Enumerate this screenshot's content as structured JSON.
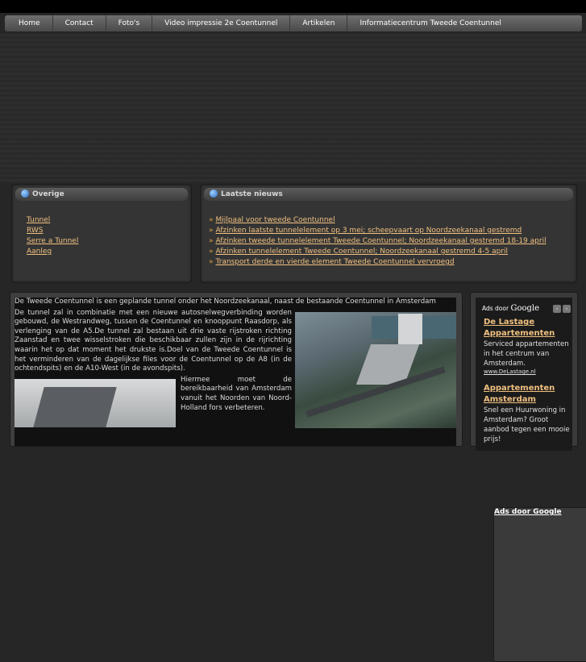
{
  "nav": {
    "items": [
      "Home",
      "Contact",
      "Foto's",
      "Video impressie 2e Coentunnel",
      "Artikelen",
      "Informatiecentrum Tweede Coentunnel"
    ]
  },
  "overige": {
    "title": "Overige",
    "ads_label": "Ads door Google",
    "links": [
      "Tunnel",
      "RWS",
      "Serre a Tunnel",
      "Aanleg"
    ]
  },
  "news": {
    "title": "Laatste nieuws",
    "items": [
      "Mijlpaal voor tweede Coentunnel",
      "Afzinken laatste tunnelelement op 3 mei; scheepvaart op Noordzeekanaal gestremd",
      "Afzinken tweede tunnelelement Tweede Coentunnel; Noordzeekanaal gestremd 18-19 april",
      "Afzinken tunnelelement Tweede Coentunnel; Noordzeekanaal gestremd 4-5 april",
      "Transport derde en vierde element Tweede Coentunnel vervroegd"
    ]
  },
  "article": {
    "p1": "De Tweede Coentunnel is een geplande tunnel onder het Noordzeekanaal, naast de bestaande Coentunnel in Amsterdam",
    "p2": "De tunnel zal in combinatie met een nieuwe autosnelwegverbinding worden gebouwd, de Westrandweg, tussen de Coentunnel en knooppunt Raasdorp, als verlenging van de A5.De tunnel zal bestaan uit drie vaste rijstroken richting Zaanstad en twee wisselstroken die beschikbaar zullen zijn in de rijrichting waarin het op dat moment het drukste is.Doel van de Tweede Coentunnel is het verminderen van de dagelijkse files voor de Coentunnel op de A8 (in de ochtendspits) en de A10-West (in de avondspits).",
    "p3": "Hiermee moet de bereikbaarheid van Amsterdam vanuit het Noorden van Noord-Holland fors verbeteren."
  },
  "ads": {
    "label_prefix": "Ads door",
    "label_brand": "Google",
    "prev": "‹",
    "next": "›",
    "items": [
      {
        "title": "De Lastage Appartementen",
        "desc": "Serviced appartementen in het centrum van Amsterdam.",
        "url": "www.DeLastage.nl"
      },
      {
        "title": "Appartementen Amsterdam",
        "desc": "Snel een Huurwoning in Amsterdam? Groot aanbod tegen een mooie prijs!"
      }
    ]
  }
}
